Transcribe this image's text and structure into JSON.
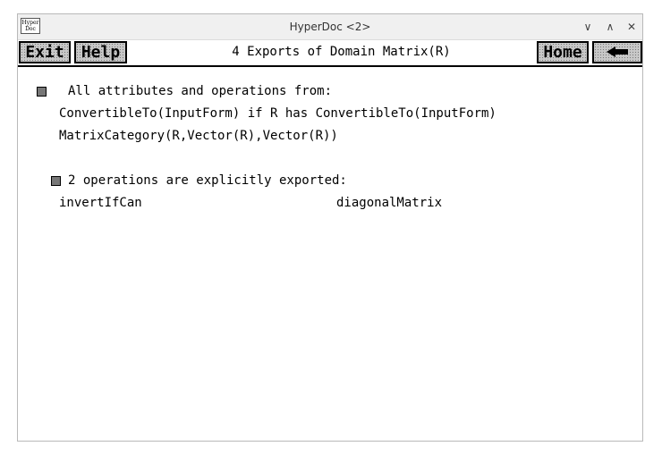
{
  "window": {
    "title": "HyperDoc <2>",
    "icon_text_line1": "Hyper",
    "icon_text_line2": "Doc",
    "controls": {
      "minimize": "∨",
      "maximize": "∧",
      "close": "✕"
    }
  },
  "toolbar": {
    "exit_label": "Exit",
    "help_label": "Help",
    "home_label": "Home",
    "back_icon": "left-arrow-icon",
    "page_title": "4 Exports of Domain Matrix(R)"
  },
  "content": {
    "section1": {
      "heading": "All attributes and operations from:",
      "line1": "ConvertibleTo(InputForm) if R has ConvertibleTo(InputForm)",
      "line2": "MatrixCategory(R,Vector(R),Vector(R))"
    },
    "section2": {
      "heading": "2 operations are explicitly exported:",
      "operations": [
        "invertIfCan",
        "diagonalMatrix"
      ]
    }
  }
}
